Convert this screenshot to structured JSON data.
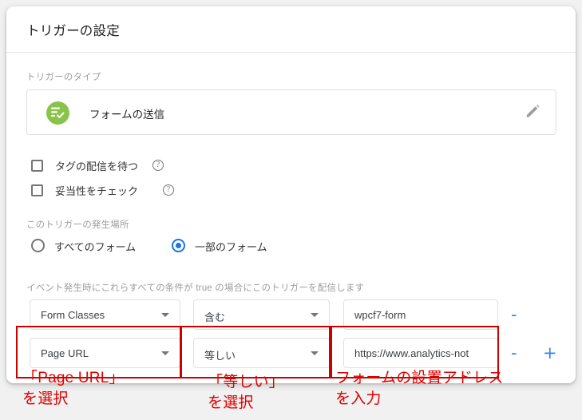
{
  "dialog": {
    "title": "トリガーの設定"
  },
  "trigger_type": {
    "label": "トリガーのタイプ",
    "name": "フォームの送信",
    "icon": "form-submit-icon",
    "icon_color": "#8bc34a",
    "edit_icon": "pencil-icon"
  },
  "checkboxes": [
    {
      "label": "タグの配信を待つ",
      "checked": false,
      "help": "?"
    },
    {
      "label": "妥当性をチェック",
      "checked": false,
      "help": "?"
    }
  ],
  "where": {
    "label": "このトリガーの発生場所",
    "options": [
      {
        "label": "すべてのフォーム",
        "selected": false
      },
      {
        "label": "一部のフォーム",
        "selected": true
      }
    ],
    "accent_color": "#1a73e8"
  },
  "conditions": {
    "label": "イベント発生時にこれらすべての条件が true の場合にこのトリガーを配信します",
    "rows": [
      {
        "variable": "Form Classes",
        "operator": "含む",
        "value": "wpcf7-form",
        "remove_label": "-",
        "add_label": ""
      },
      {
        "variable": "Page URL",
        "operator": "等しい",
        "value": "https://www.analytics-not",
        "remove_label": "-",
        "add_label": "+"
      }
    ]
  },
  "annotations": {
    "color": "#e00000",
    "items": [
      "「Page URL」\nを選択",
      "「等しい」\nを選択",
      "フォームの設置アドレス\nを入力"
    ]
  }
}
